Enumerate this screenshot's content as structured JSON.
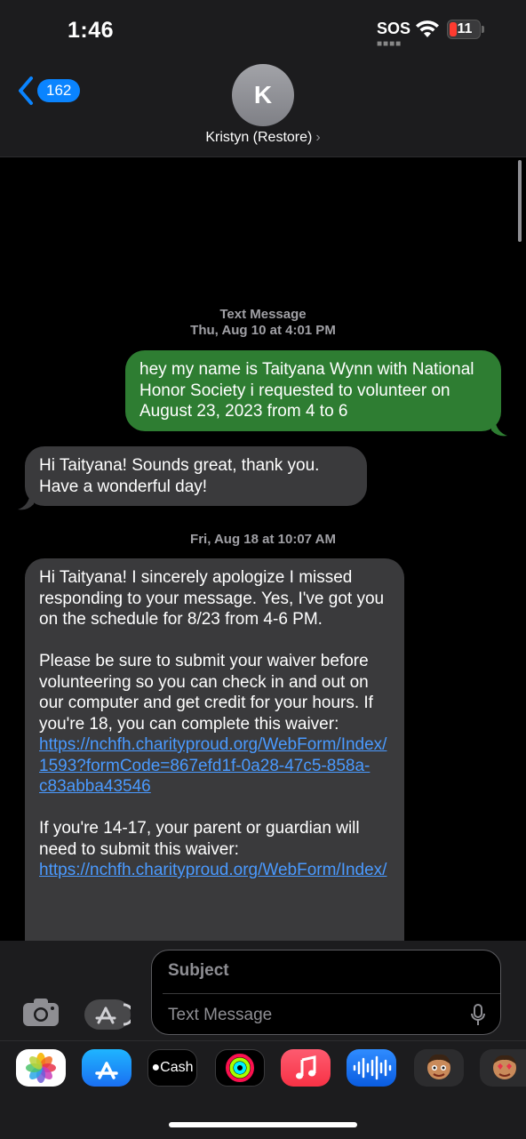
{
  "status_bar": {
    "time": "1:46",
    "sos": "SOS",
    "battery": "11"
  },
  "header": {
    "back_count": "162",
    "avatar_initial": "K",
    "contact_name": "Kristyn (Restore)",
    "contact_chevron": "›"
  },
  "messages": {
    "stamp1_label": "Text Message",
    "stamp1_time": "Thu, Aug 10 at 4:01 PM",
    "sent1": "hey my name is Taityana Wynn with National Honor Society i requested to volunteer on August 23, 2023 from 4 to 6",
    "recv1": "Hi Taityana! Sounds great, thank you. Have a wonderful day!",
    "stamp2_time": "Fri, Aug 18 at 10:07 AM",
    "recv2_p1": "Hi Taityana! I sincerely apologize I missed responding to your message. Yes, I've got you on the schedule for 8/23 from 4-6 PM.",
    "recv2_p2": "Please be sure to submit your waiver before volunteering so you can check in and out on our computer and get credit for your hours. If you're 18, you can complete this waiver: ",
    "recv2_link1": "https://nchfh.charityproud.org/WebForm/Index/1593?formCode=867efd1f-0a28-47c5-858a-c83abba43546",
    "recv2_p3": "If you're 14-17, your parent or guardian will need to submit this waiver: ",
    "recv2_link2": "https://nchfh.charityproud.org/WebForm/Index/"
  },
  "composer": {
    "subject_placeholder": "Subject",
    "text_placeholder": "Text Message"
  },
  "app_drawer": {
    "apps": [
      "Photos",
      "App Store",
      "Cash",
      "Fitness",
      "Music",
      "Audio Message",
      "Memoji",
      "Memoji Stickers"
    ],
    "cash_label": "Cash"
  },
  "colors": {
    "sent_bubble": "#2e7d32",
    "received_bubble": "#3a3a3c",
    "link": "#4a9aff",
    "accent": "#0a84ff"
  }
}
